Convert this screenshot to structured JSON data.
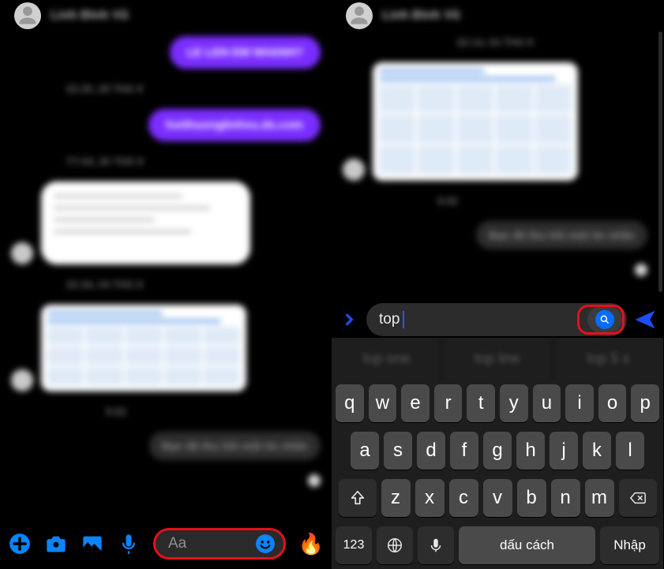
{
  "header": {
    "username": "Linh Đình Vũ"
  },
  "left": {
    "chat": {
      "ts0": "22:25, 28 THG 9",
      "bub_purple": "hoithuonglinhvu.ds.com",
      "ts1": "T7:04, 30 THG 9",
      "ts2": "22:34, 04 THG 9",
      "ts3": "9:02",
      "note": "Bạn đã thu hồi một tin nhắn"
    },
    "input_placeholder": "Aa"
  },
  "right": {
    "chat": {
      "ts0": "22:14, 04 THG 9",
      "ts1": "9:02",
      "note": "Bạn đã thu hồi một tin nhắn"
    },
    "input_value": "top"
  },
  "keyboard": {
    "suggestions": [
      "top one",
      "top line",
      "top 5 s"
    ],
    "row1": [
      "q",
      "w",
      "e",
      "r",
      "t",
      "y",
      "u",
      "i",
      "o",
      "p"
    ],
    "row2": [
      "a",
      "s",
      "d",
      "f",
      "g",
      "h",
      "j",
      "k",
      "l"
    ],
    "row3": [
      "z",
      "x",
      "c",
      "v",
      "b",
      "n",
      "m"
    ],
    "num": "123",
    "space": "dấu cách",
    "return": "Nhập"
  }
}
